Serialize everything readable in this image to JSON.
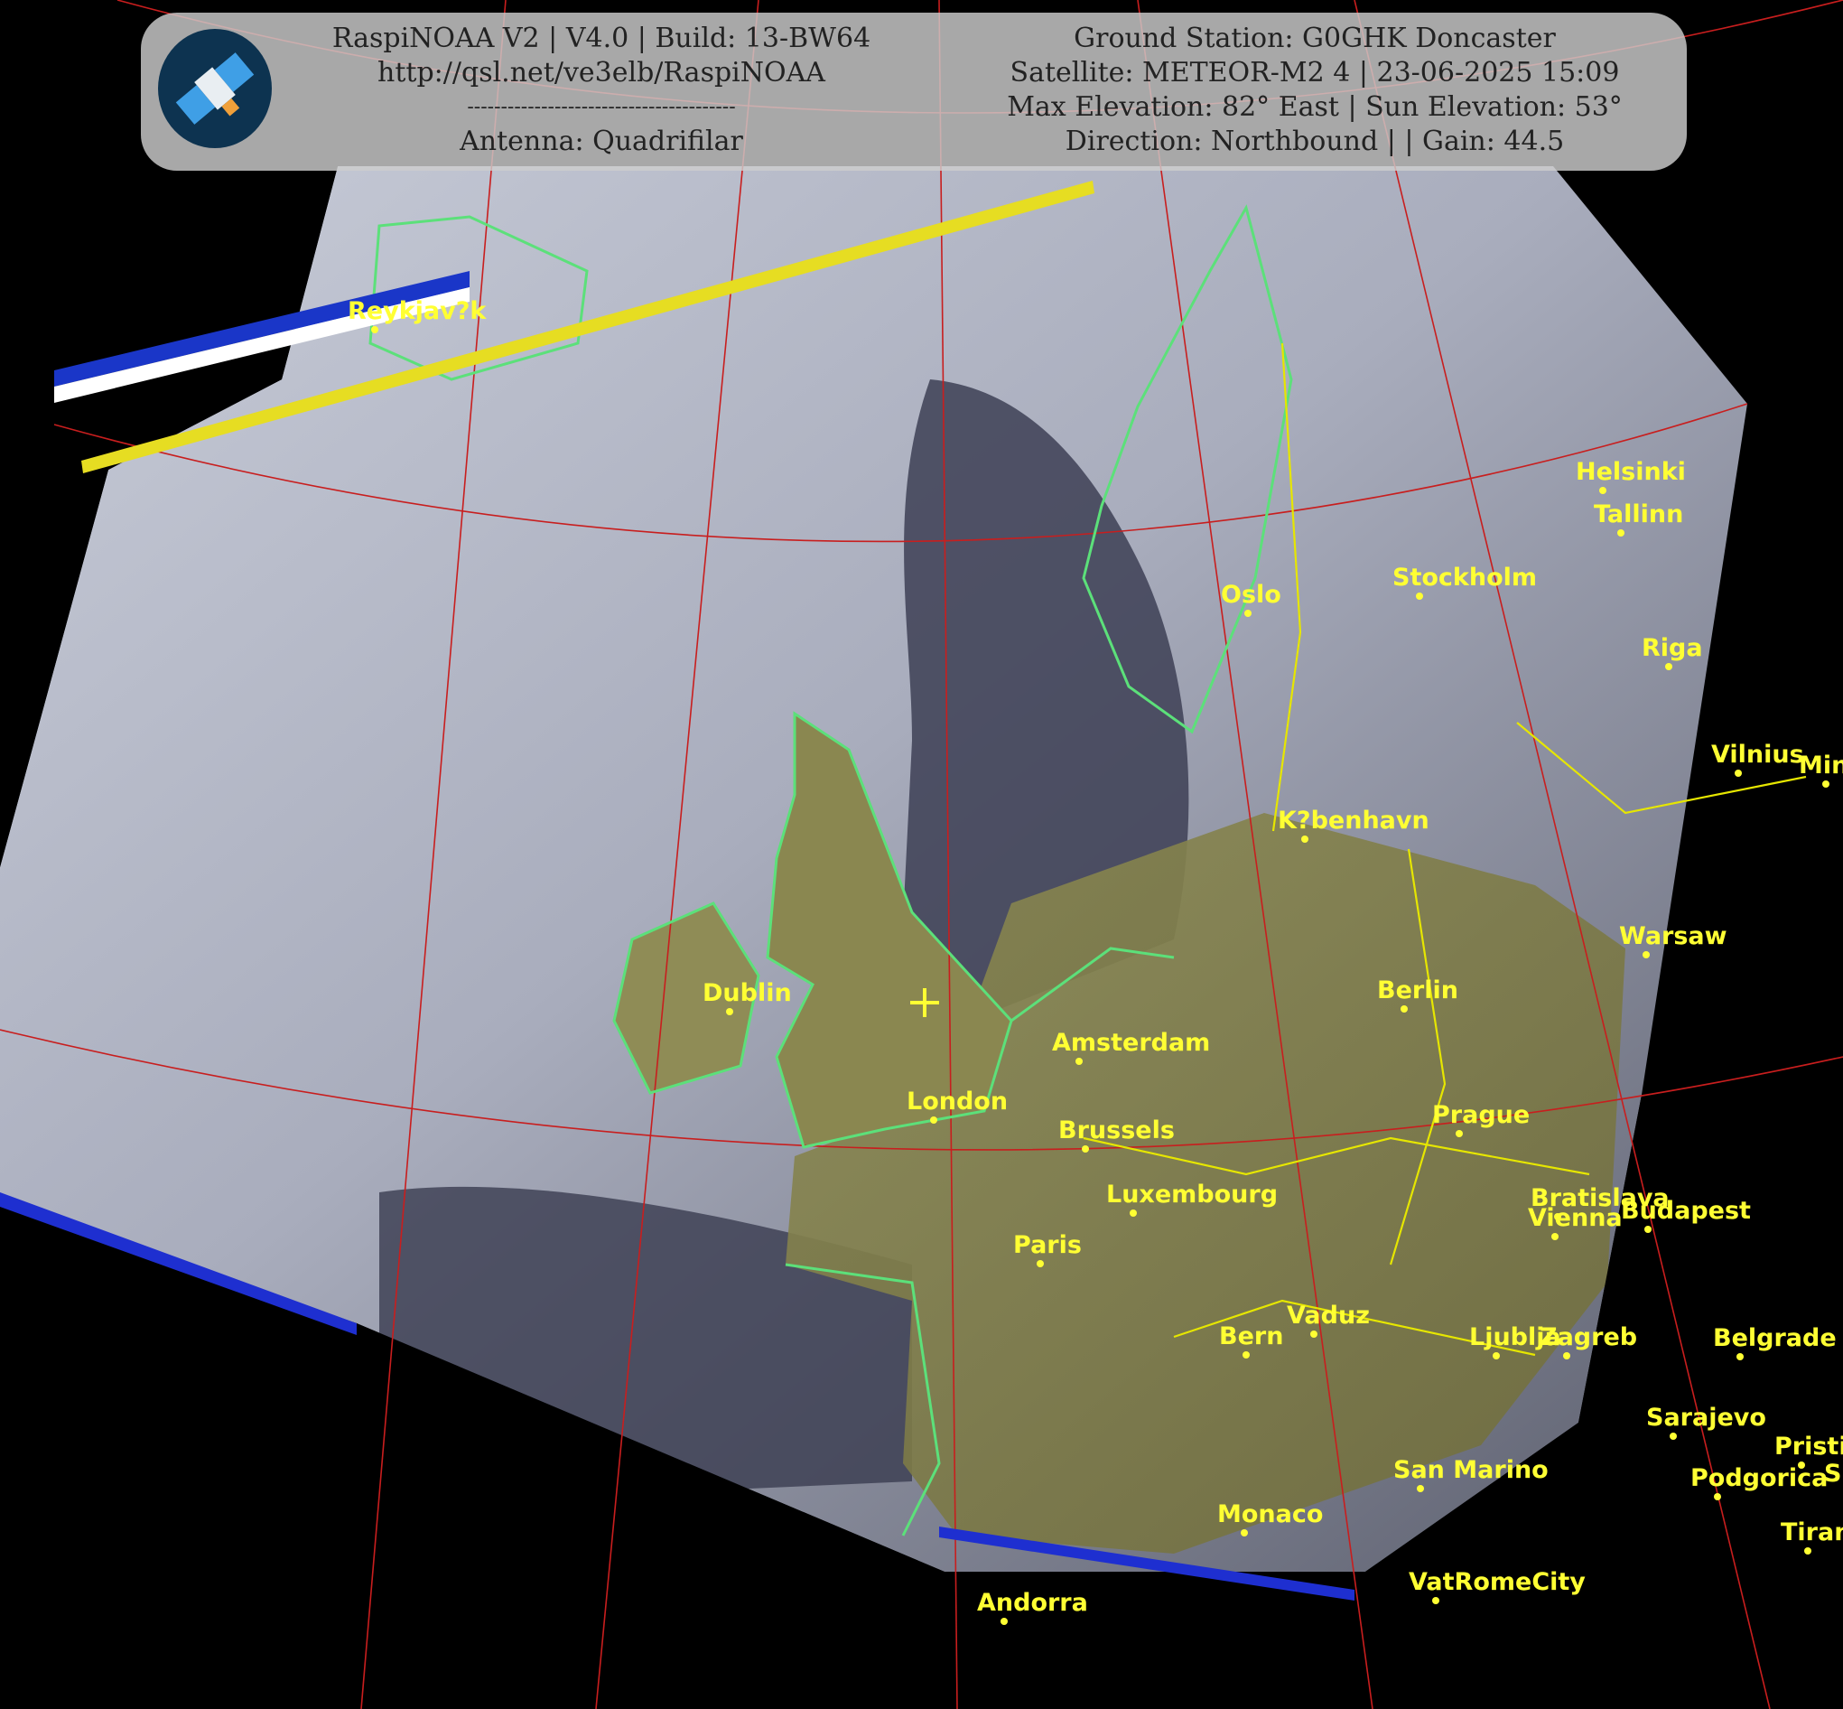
{
  "header": {
    "left_lines": [
      "RaspiNOAA V2 | V4.0 | Build: 13-BW64",
      "http://qsl.net/ve3elb/RaspiNOAA",
      "----------------------------------------",
      "Antenna: Quadrifilar"
    ],
    "right_lines": [
      "Ground Station: G0GHK Doncaster",
      "Satellite: METEOR-M2 4 | 23-06-2025 15:09",
      "Max Elevation: 82° East | Sun Elevation: 53°",
      "Direction: Northbound | | Gain: 44.5"
    ],
    "logo_icon": "satellite-icon"
  },
  "cities": [
    {
      "name": "Reykjav?k"
    },
    {
      "name": "Helsinki"
    },
    {
      "name": "Tallinn"
    },
    {
      "name": "Oslo"
    },
    {
      "name": "Stockholm"
    },
    {
      "name": "Riga"
    },
    {
      "name": "Vilnius"
    },
    {
      "name": "Mins"
    },
    {
      "name": "K?benhavn"
    },
    {
      "name": "Dublin"
    },
    {
      "name": "Warsaw"
    },
    {
      "name": "Berlin"
    },
    {
      "name": "Amsterdam"
    },
    {
      "name": "London"
    },
    {
      "name": "Brussels"
    },
    {
      "name": "Prague"
    },
    {
      "name": "Luxembourg"
    },
    {
      "name": "Vienna"
    },
    {
      "name": "Bratislava"
    },
    {
      "name": "Budapest"
    },
    {
      "name": "Paris"
    },
    {
      "name": "Vaduz"
    },
    {
      "name": "Bern"
    },
    {
      "name": "Ljublja"
    },
    {
      "name": "Zagreb"
    },
    {
      "name": "Belgrade"
    },
    {
      "name": "Sarajevo"
    },
    {
      "name": "Pristi"
    },
    {
      "name": "Sko"
    },
    {
      "name": "Podgorica"
    },
    {
      "name": "San Marino"
    },
    {
      "name": "Monaco"
    },
    {
      "name": "Tirana"
    },
    {
      "name": "VatRomeCity"
    },
    {
      "name": "Andorra"
    }
  ],
  "colors": {
    "coastline": "#5ce07a",
    "borders": "#e6e600",
    "grid": "#c81e1e",
    "labels": "#ffff33"
  }
}
